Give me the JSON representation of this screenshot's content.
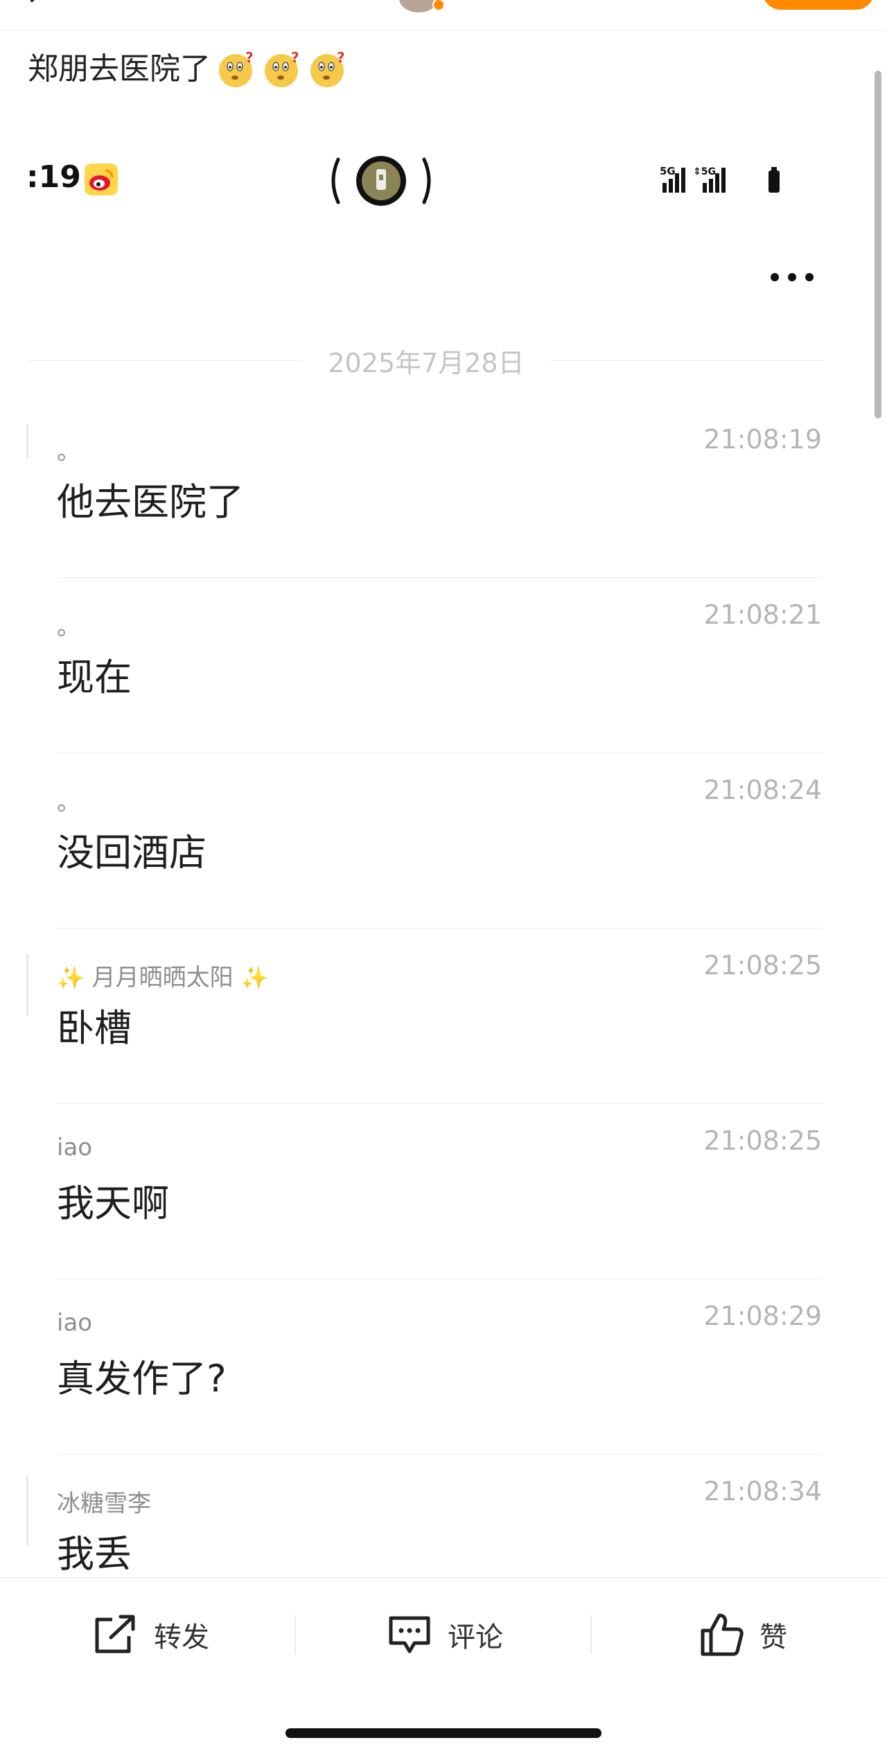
{
  "nav": {
    "title": "",
    "back_icon": "chevron-left-icon",
    "follow_color": "#ff8a00"
  },
  "post": {
    "text": "郑朋去医院了",
    "emojis": [
      "thinking-face-icon",
      "thinking-face-icon",
      "thinking-face-icon"
    ]
  },
  "screenshot": {
    "status_time": ":19",
    "status_icons": [
      "weibo-icon",
      "flashlight-icon",
      "signal-5g-icon",
      "signal-5g-icon",
      "battery-icon"
    ],
    "date_separator": "2025年7月28日",
    "messages": [
      {
        "name": "。",
        "time": "21:08:19",
        "text": "他去医院了"
      },
      {
        "name": "。",
        "time": "21:08:21",
        "text": "现在"
      },
      {
        "name": "。",
        "time": "21:08:24",
        "text": "没回酒店"
      },
      {
        "name": "月月晒晒太阳",
        "time": "21:08:25",
        "text": "卧槽"
      },
      {
        "name": "iao",
        "time": "21:08:25",
        "text": "我天啊"
      },
      {
        "name": "iao",
        "time": "21:08:29",
        "text": "真发作了?"
      },
      {
        "name": "冰糖雪李",
        "time": "21:08:34",
        "text": "我丢"
      }
    ]
  },
  "actions": {
    "repost": "转发",
    "comment": "评论",
    "like": "赞"
  },
  "colors": {
    "accent": "#ff8a00",
    "sparkle": "#f3cf3a"
  }
}
